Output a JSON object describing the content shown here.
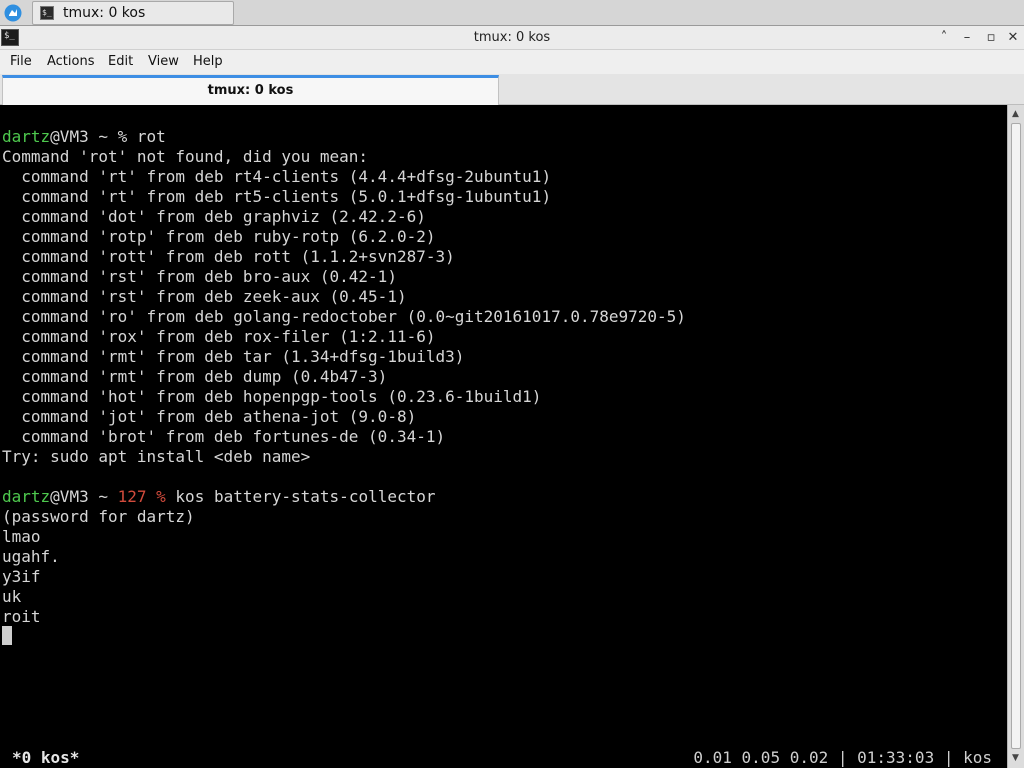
{
  "taskbar": {
    "task_label": "tmux: 0 kos",
    "task_icon_glyph": "$_"
  },
  "window": {
    "title": "tmux: 0 kos",
    "icon_glyph": "$_",
    "controls": {
      "up": "˄",
      "minimize": "–",
      "maximize": "▫",
      "close": "✕"
    }
  },
  "menubar": {
    "items": [
      "File",
      "Actions",
      "Edit",
      "View",
      "Help"
    ]
  },
  "tabs": [
    {
      "label": "tmux: 0 kos",
      "active": true
    }
  ],
  "terminal": {
    "prompt1": {
      "user": "dartz",
      "host_path": "@VM3 ~ % ",
      "command": "rot"
    },
    "lines": [
      "Command 'rot' not found, did you mean:",
      "  command 'rt' from deb rt4-clients (4.4.4+dfsg-2ubuntu1)",
      "  command 'rt' from deb rt5-clients (5.0.1+dfsg-1ubuntu1)",
      "  command 'dot' from deb graphviz (2.42.2-6)",
      "  command 'rotp' from deb ruby-rotp (6.2.0-2)",
      "  command 'rott' from deb rott (1.1.2+svn287-3)",
      "  command 'rst' from deb bro-aux (0.42-1)",
      "  command 'rst' from deb zeek-aux (0.45-1)",
      "  command 'ro' from deb golang-redoctober (0.0~git20161017.0.78e9720-5)",
      "  command 'rox' from deb rox-filer (1:2.11-6)",
      "  command 'rmt' from deb tar (1.34+dfsg-1build3)",
      "  command 'rmt' from deb dump (0.4b47-3)",
      "  command 'hot' from deb hopenpgp-tools (0.23.6-1build1)",
      "  command 'jot' from deb athena-jot (9.0-8)",
      "  command 'brot' from deb fortunes-de (0.34-1)",
      "Try: sudo apt install <deb name>"
    ],
    "prompt2": {
      "user": "dartz",
      "host_path": "@VM3 ~ ",
      "exit_code": "127",
      "symbol": " % ",
      "command": "kos battery-stats-collector"
    },
    "output": [
      "(password for dartz)",
      "lmao",
      "ugahf.",
      "y3if",
      "uk",
      "roit"
    ],
    "status_left": "*0 kos*",
    "status_right": "0.01 0.05 0.02 | 01:33:03 | kos",
    "colors": {
      "user": "#4ec94e",
      "exit_code": "#d24b3c",
      "text": "#d6d6d6",
      "background": "#000000"
    }
  }
}
